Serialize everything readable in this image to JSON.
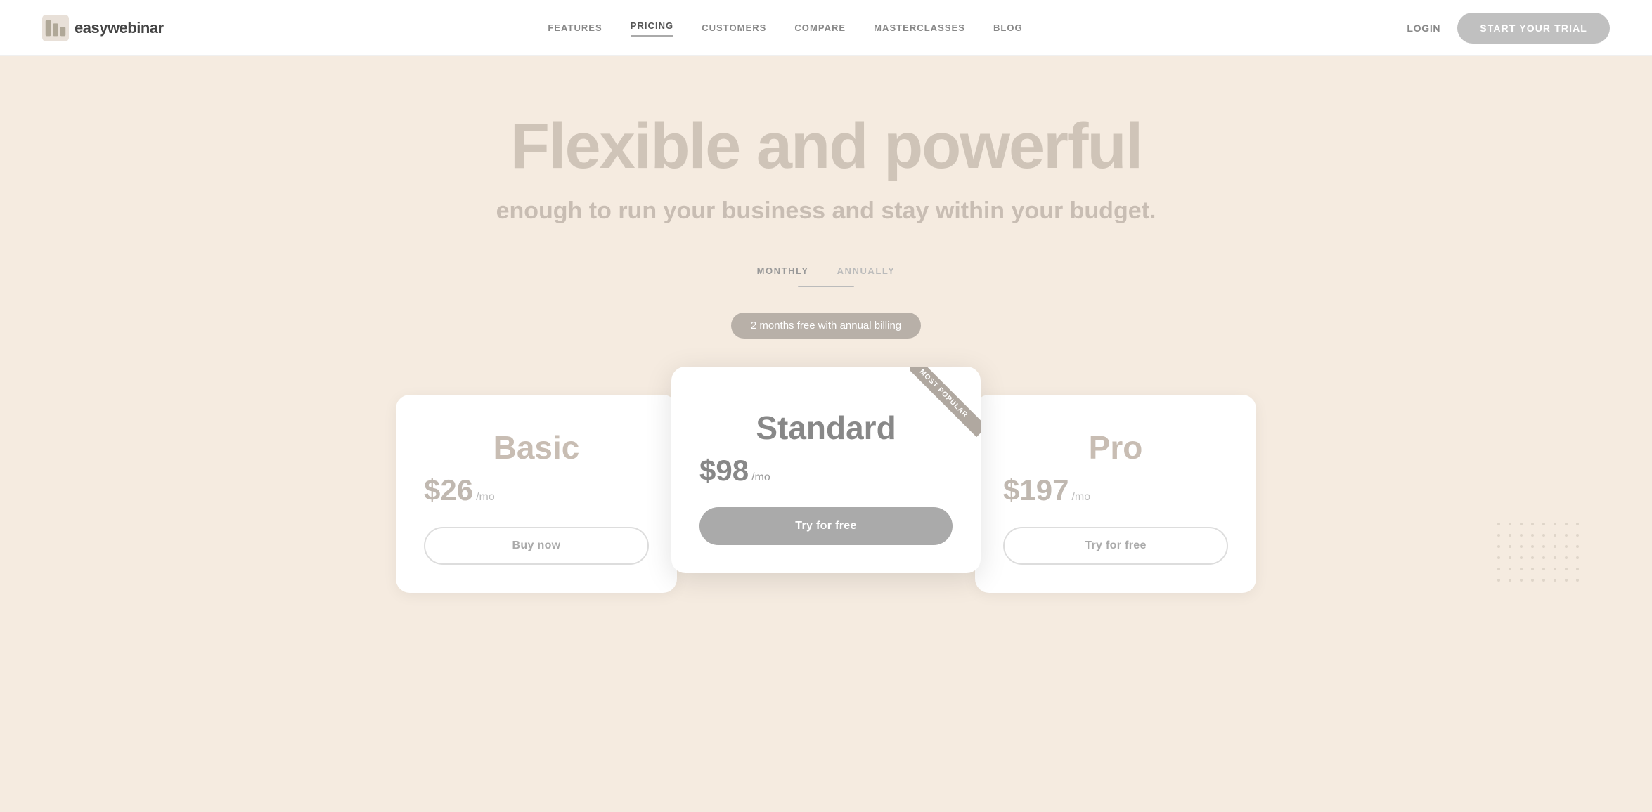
{
  "navbar": {
    "logo_text": "easywebinar",
    "nav_items": [
      {
        "label": "FEATURES",
        "active": false
      },
      {
        "label": "PRICING",
        "active": true
      },
      {
        "label": "CUSTOMERS",
        "active": false
      },
      {
        "label": "COMPARE",
        "active": false
      },
      {
        "label": "MASTERCLASSES",
        "active": false
      },
      {
        "label": "BLOG",
        "active": false
      }
    ],
    "login_label": "LOGIN",
    "trial_button": "START YOUR TRIAL"
  },
  "hero": {
    "title": "Flexible and powerful",
    "subtitle": "enough to run your business and stay within your budget.",
    "billing_monthly": "MONTHLY",
    "billing_annually": "ANNUALLY",
    "annual_badge": "2 months free with annual billing"
  },
  "pricing": {
    "cards": [
      {
        "name": "Basic",
        "price": "$26",
        "period": "/mo",
        "button": "Buy now",
        "type": "basic"
      },
      {
        "name": "Standard",
        "price": "$98",
        "period": "/mo",
        "button": "Try for free",
        "type": "standard",
        "badge": "MOST POPULAR"
      },
      {
        "name": "Pro",
        "price": "$197",
        "period": "/mo",
        "button": "Try for free",
        "type": "pro"
      }
    ]
  }
}
